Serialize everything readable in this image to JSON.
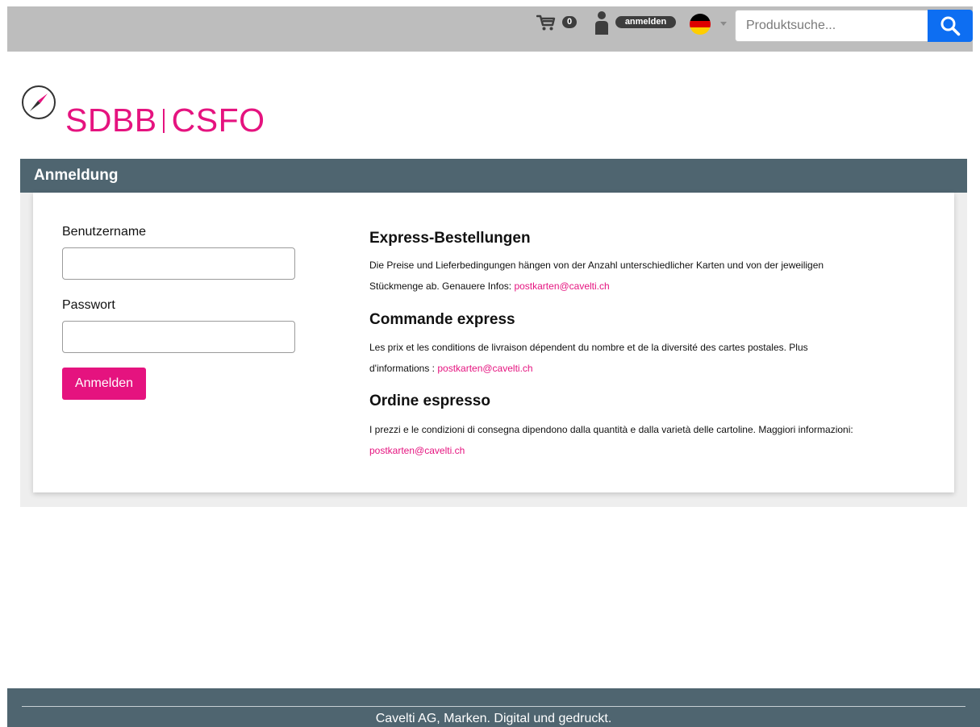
{
  "header": {
    "cart_count": "0",
    "login_label": "anmelden",
    "language": "de",
    "search_placeholder": "Produktsuche..."
  },
  "brand": {
    "logo_left": "SDBB",
    "logo_right": "CSFO",
    "accent_color": "#e5137f"
  },
  "login_panel": {
    "title": "Anmeldung",
    "username_label": "Benutzername",
    "username_value": "",
    "password_label": "Passwort",
    "password_value": "",
    "submit_label": "Anmelden"
  },
  "info": [
    {
      "heading": "Express-Bestellungen",
      "text": "Die Preise und Lieferbedingungen hängen von der Anzahl unterschiedlicher Karten und von der jeweiligen Stückmenge ab. Genauere Infos:",
      "email": "postkarten@cavelti.ch"
    },
    {
      "heading": "Commande express",
      "text": "Les prix et les conditions de livraison dépendent du nombre et de la diversité des cartes postales. Plus d'informations :",
      "email": "postkarten@cavelti.ch"
    },
    {
      "heading": "Ordine espresso",
      "text": "I prezzi e le condizioni di consegna dipendono dalla quantità e dalla varietà delle cartoline. Maggiori informazioni:",
      "email": "postkarten@cavelti.ch"
    }
  ],
  "footer": {
    "text": "Cavelti AG, Marken. Digital und gedruckt."
  },
  "colors": {
    "header_bar": "#bdbdbd",
    "panel_header": "#4f6570",
    "search_button": "#0d6ef2"
  }
}
